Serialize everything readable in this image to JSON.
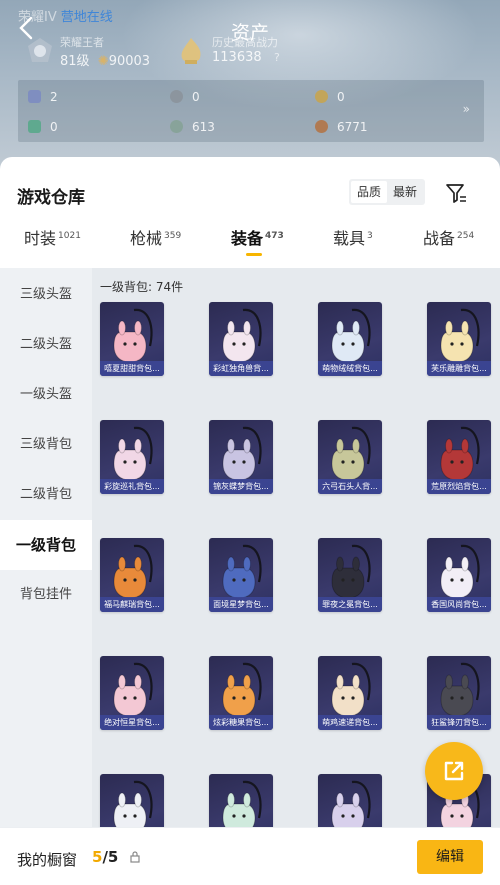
{
  "header": {
    "breadcrumb": "营地在线",
    "title": "资产",
    "stats": [
      {
        "label": "荣耀王者",
        "value": "81级",
        "extra": "90003"
      },
      {
        "label": "历史最高战力",
        "value": "113638",
        "extra": "?"
      }
    ],
    "resources": [
      {
        "icon": "ticket-icon",
        "value": "2",
        "color": "#7f8ec0"
      },
      {
        "icon": "coin-silver-icon",
        "value": "0",
        "color": "#8c959e"
      },
      {
        "icon": "coin-gold-icon",
        "value": "0",
        "color": "#c2a55a"
      },
      {
        "icon": "card-green-icon",
        "value": "0",
        "color": "#5fa98f"
      },
      {
        "icon": "shell-icon",
        "value": "613",
        "color": "#88a39a"
      },
      {
        "icon": "coin-bronze-icon",
        "value": "6771",
        "color": "#b07a52"
      }
    ],
    "more_arrow": "»"
  },
  "warehouse": {
    "title": "游戏仓库",
    "sort": [
      "品质",
      "最新"
    ],
    "sort_active": 0
  },
  "tabs": [
    {
      "label": "时装",
      "count": "1021"
    },
    {
      "label": "枪械",
      "count": "359"
    },
    {
      "label": "装备",
      "count": "473"
    },
    {
      "label": "载具",
      "count": "3"
    },
    {
      "label": "战备",
      "count": "254"
    }
  ],
  "active_tab": 2,
  "sidebar": {
    "items": [
      "三级头盔",
      "二级头盔",
      "一级头盔",
      "三级背包",
      "二级背包",
      "一级背包",
      "背包挂件"
    ],
    "active": 5
  },
  "grid": {
    "header": "一级背包: 74件",
    "items": [
      {
        "name": "嘻夏甜甜背包...",
        "color": "#f5b7c5"
      },
      {
        "name": "彩虹独角兽背...",
        "color": "#f3e6ef"
      },
      {
        "name": "萌物绒绒背包...",
        "color": "#dfe9f5"
      },
      {
        "name": "芙乐雕雕背包...",
        "color": "#f5e3b0"
      },
      {
        "name": "彩旋巡礼背包...",
        "color": "#f1d7e6"
      },
      {
        "name": "锦灰蝶梦背包...",
        "color": "#c9c4e2"
      },
      {
        "name": "六弓石头人背...",
        "color": "#c7c79a"
      },
      {
        "name": "荒原烈焰背包...",
        "color": "#b43838"
      },
      {
        "name": "福马麒瑞背包...",
        "color": "#e88a3a"
      },
      {
        "name": "面境星梦背包...",
        "color": "#4f6bbf"
      },
      {
        "name": "罪夜之冕背包...",
        "color": "#2e2e3a"
      },
      {
        "name": "香国风尚背包...",
        "color": "#f2eef6"
      },
      {
        "name": "绝对恒星背包...",
        "color": "#f3c8d4"
      },
      {
        "name": "炫彩糖果背包...",
        "color": "#f0a04a"
      },
      {
        "name": "萌鸡速递背包...",
        "color": "#f2e0c8"
      },
      {
        "name": "狂鲨锋刃背包...",
        "color": "#4a4a52"
      },
      {
        "name": "",
        "color": "#eef0f5"
      },
      {
        "name": "",
        "color": "#cfeadd"
      },
      {
        "name": "",
        "color": "#d8d0ec"
      },
      {
        "name": "",
        "color": "#f3d3e0"
      }
    ]
  },
  "footer": {
    "label": "我的橱窗",
    "current": "5",
    "total": "/5",
    "edit_label": "编辑"
  }
}
